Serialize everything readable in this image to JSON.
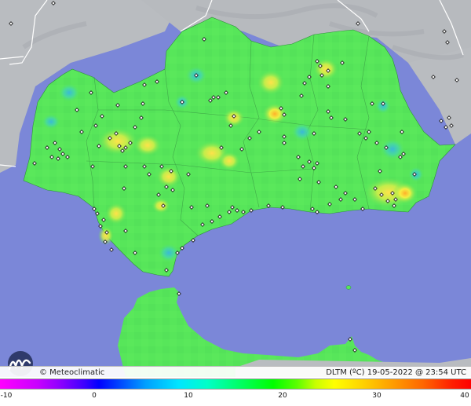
{
  "footer": {
    "copyright": "© Meteoclimatic",
    "legend_title": "DLTM (ºC)  19-05-2022 @ 23:54 UTC"
  },
  "scale": {
    "ticks": [
      {
        "label": "-10",
        "value": -10
      },
      {
        "label": "0",
        "value": 0
      },
      {
        "label": "10",
        "value": 10
      },
      {
        "label": "20",
        "value": 20
      },
      {
        "label": "30",
        "value": 30
      },
      {
        "label": "40",
        "value": 40
      }
    ],
    "min": -10,
    "max": 40
  },
  "colors": {
    "sea": "#7b87d8",
    "land_outside": "#b9bcc0",
    "field_base": "#57e65a",
    "warm_spot": "#e6e84a",
    "cool_spot": "#3fd0b0"
  },
  "icons": {
    "logo": "meteoclimatic-logo-icon",
    "station": "station-marker-icon"
  }
}
